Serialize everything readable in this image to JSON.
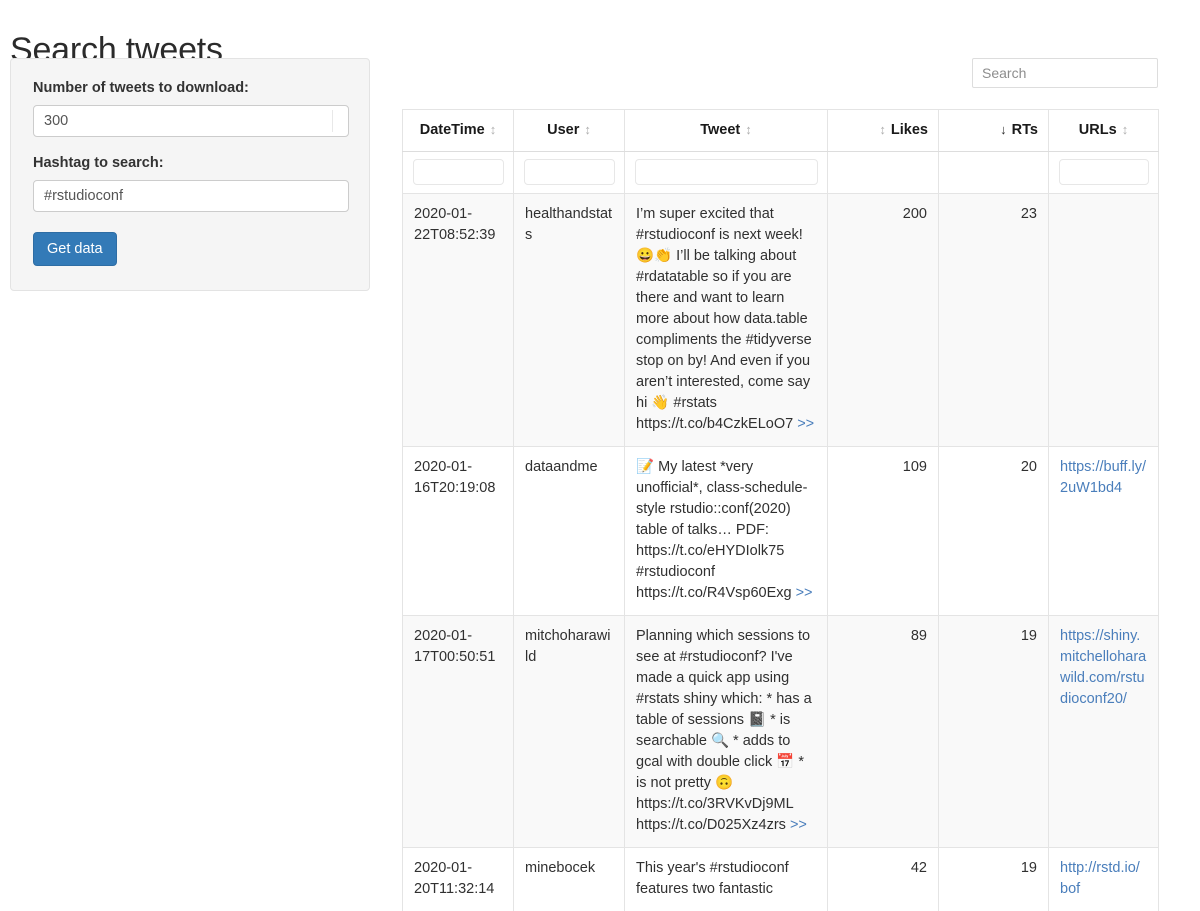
{
  "app": {
    "title": "Search tweets"
  },
  "sidebar": {
    "num_tweets_label": "Number of tweets to download:",
    "num_tweets_value": "300",
    "hashtag_label": "Hashtag to search:",
    "hashtag_value": "#rstudioconf",
    "get_data_label": "Get data"
  },
  "table": {
    "search_placeholder": "Search",
    "search_value": "",
    "columns": [
      {
        "label": "DateTime",
        "sort": "none",
        "sort_glyph": "↕",
        "align": "left",
        "filterable": true
      },
      {
        "label": "User",
        "sort": "none",
        "sort_glyph": "↕",
        "align": "left",
        "filterable": true
      },
      {
        "label": "Tweet",
        "sort": "none",
        "sort_glyph": "↕",
        "align": "left",
        "filterable": true
      },
      {
        "label": "Likes",
        "sort": "none",
        "sort_glyph": "↕",
        "align": "right",
        "filterable": false
      },
      {
        "label": "RTs",
        "sort": "descending",
        "sort_glyph": "↓",
        "align": "right",
        "filterable": false
      },
      {
        "label": "URLs",
        "sort": "none",
        "sort_glyph": "↕",
        "align": "left",
        "filterable": true
      }
    ],
    "filters": [
      "",
      "",
      "",
      null,
      null,
      ""
    ],
    "expand_label": ">>",
    "rows": [
      {
        "datetime": "2020-01-22T08:52:39",
        "user": "healthandstats",
        "tweet": "I’m super excited that #rstudioconf is next week! 😀👏 I’ll be talking about #rdatatable so if you are there and want to learn more about how data.table compliments the #tidyverse stop on by! And even if you aren’t interested, come say hi 👋 #rstats https://t.co/b4CzkELoO7",
        "likes": "200",
        "rts": "23",
        "url": ""
      },
      {
        "datetime": "2020-01-16T20:19:08",
        "user": "dataandme",
        "tweet": "📝 My latest *very unofficial*, class-schedule-style rstudio::conf(2020) table of talks… PDF: https://t.co/eHYDIolk75 #rstudioconf https://t.co/R4Vsp60Exg",
        "likes": "109",
        "rts": "20",
        "url": "https://buff.ly/2uW1bd4"
      },
      {
        "datetime": "2020-01-17T00:50:51",
        "user": "mitchoharawild",
        "tweet": "Planning which sessions to see at #rstudioconf? I've made a quick app using #rstats shiny which: * has a table of sessions 📓 * is searchable 🔍 * adds to gcal with double click 📅 * is not pretty 🙃 https://t.co/3RVKvDj9ML https://t.co/D025Xz4zrs",
        "likes": "89",
        "rts": "19",
        "url": "https://shiny.mitchelloharawild.com/rstudioconf20/"
      },
      {
        "datetime": "2020-01-20T11:32:14",
        "user": "minebocek",
        "tweet": "This year's #rstudioconf features two fantastic",
        "likes": "42",
        "rts": "19",
        "url": "http://rstd.io/bof"
      }
    ]
  },
  "colors": {
    "primary": "#337ab7",
    "link": "#4a7ebb",
    "panel_bg": "#f5f5f5",
    "stripe": "#f9f9f9"
  }
}
